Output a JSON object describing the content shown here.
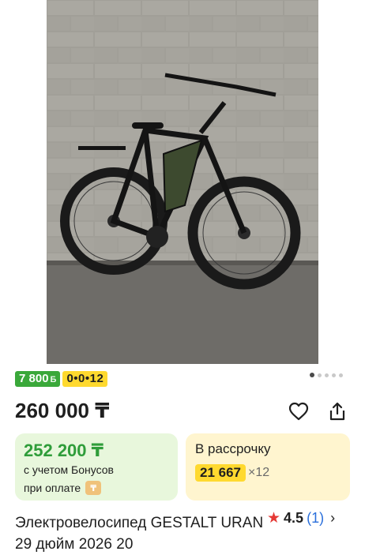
{
  "badges": {
    "bonus": "7 800",
    "bonus_currency": "Б",
    "installment": "0•0•12"
  },
  "price": "260 000 ₸",
  "icons": {
    "favorite": "heart-icon",
    "share": "share-icon",
    "rating": "star-icon",
    "more": "chevron-right-icon"
  },
  "bonus_card": {
    "price": "252 200 ₸",
    "line1": "с учетом Бонусов",
    "line2": "при оплате"
  },
  "installment_card": {
    "title": "В рассрочку",
    "amount": "21 667",
    "multiplier": "×12"
  },
  "product": {
    "title": "Электровелосипед GESTALT URAN 29 дюйм 2026 20",
    "rating": "4.5",
    "reviews": "(1)"
  },
  "colors": {
    "bonus_badge": "#3aa83a",
    "installment_badge": "#ffd92f",
    "green_card": "#e8f7dc",
    "yellow_card": "#fff5cf",
    "green_price": "#2f9d3a",
    "star": "#e53935",
    "link": "#2a6fdb"
  }
}
